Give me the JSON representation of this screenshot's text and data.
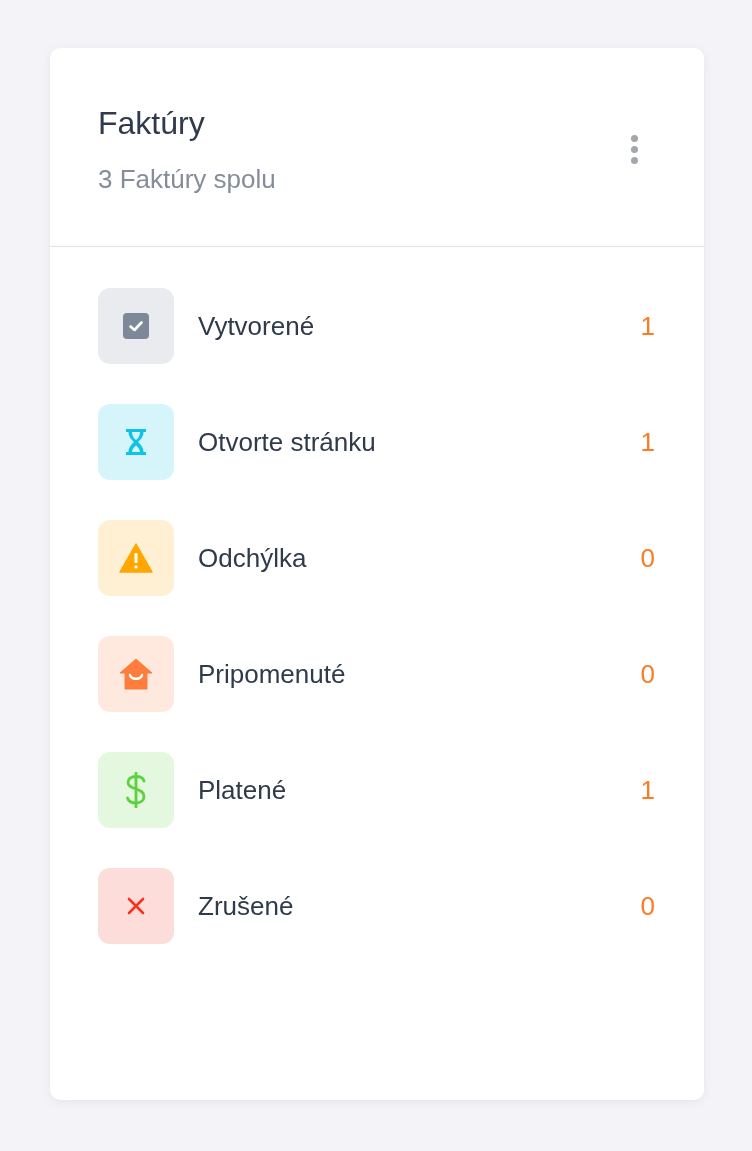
{
  "card": {
    "title": "Faktúry",
    "subtitle": "3 Faktúry spolu"
  },
  "statuses": [
    {
      "kind": "created",
      "label": "Vytvorené",
      "count": "1",
      "color": "#7d8898"
    },
    {
      "kind": "open",
      "label": "Otvorte stránku",
      "count": "1",
      "color": "#0ec2ea"
    },
    {
      "kind": "deviation",
      "label": "Odchýlka",
      "count": "0",
      "color": "#ffa600"
    },
    {
      "kind": "reminded",
      "label": "Pripomenuté",
      "count": "0",
      "color": "#fd7e3c"
    },
    {
      "kind": "paid",
      "label": "Platené",
      "count": "1",
      "color": "#5cd23f"
    },
    {
      "kind": "cancelled",
      "label": "Zrušené",
      "count": "0",
      "color": "#f5331f"
    }
  ]
}
